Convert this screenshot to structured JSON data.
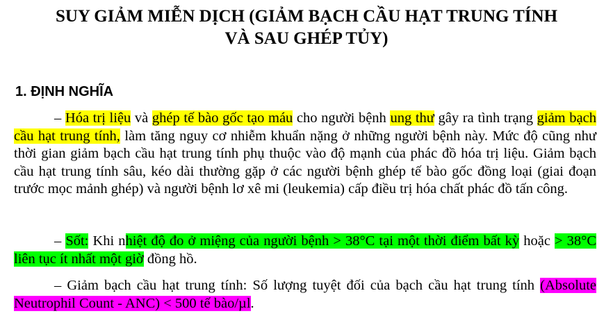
{
  "title": {
    "line1": "SUY GIẢM MIỄN DỊCH (GIẢM BẠCH CẦU HẠT TRUNG TÍNH",
    "line2": "VÀ SAU GHÉP TỦY)"
  },
  "section": {
    "heading": "1. ĐỊNH NGHĨA"
  },
  "p1": {
    "dash": "– ",
    "t1": "Hóa trị liệu",
    "t2": " và ",
    "t3": "ghép tế bào gốc tạo máu",
    "t4": " cho người bệnh ",
    "t5": "ung thư",
    "t6": " gây ra tình trạng ",
    "t7": "giảm bạch cầu hạt trung tính,",
    "t8": " làm tăng nguy cơ nhiễm khuẩn nặng ở những người bệnh này. Mức độ cũng như thời gian giảm bạch cầu hạt trung tính phụ thuộc vào độ mạnh của phác đồ hóa trị liệu. Giảm bạch cầu hạt trung tính sâu, kéo dài thường gặp ở các người bệnh ghép tế bào gốc đồng loại (giai đoạn trước mọc mảnh ghép) và người bệnh lơ xê mi (leukemia) cấp điều trị hóa chất phác đồ tấn công."
  },
  "p2": {
    "dash": "– ",
    "t1": "Sốt:",
    "t2": " Khi n",
    "t3": "hiệt độ đo ở miệng của người bệnh > 38°C tại một thời điểm bất kỳ",
    "t4": " hoặc ",
    "t5": "> 38°C liên tục ít nhất một giờ",
    "t6": " đồng hồ."
  },
  "p3": {
    "dash": "– ",
    "t1": "Giảm bạch cầu hạt trung tính: Số lượng tuyệt đối của bạch cầu hạt trung tính ",
    "t2": "(Absolute Neutrophil Count - ANC) < 500 tế bào/µl",
    "t3": "."
  },
  "colors": {
    "highlight_yellow": "#ffff00",
    "highlight_green": "#00ff00",
    "highlight_pink": "#ff00ff"
  }
}
